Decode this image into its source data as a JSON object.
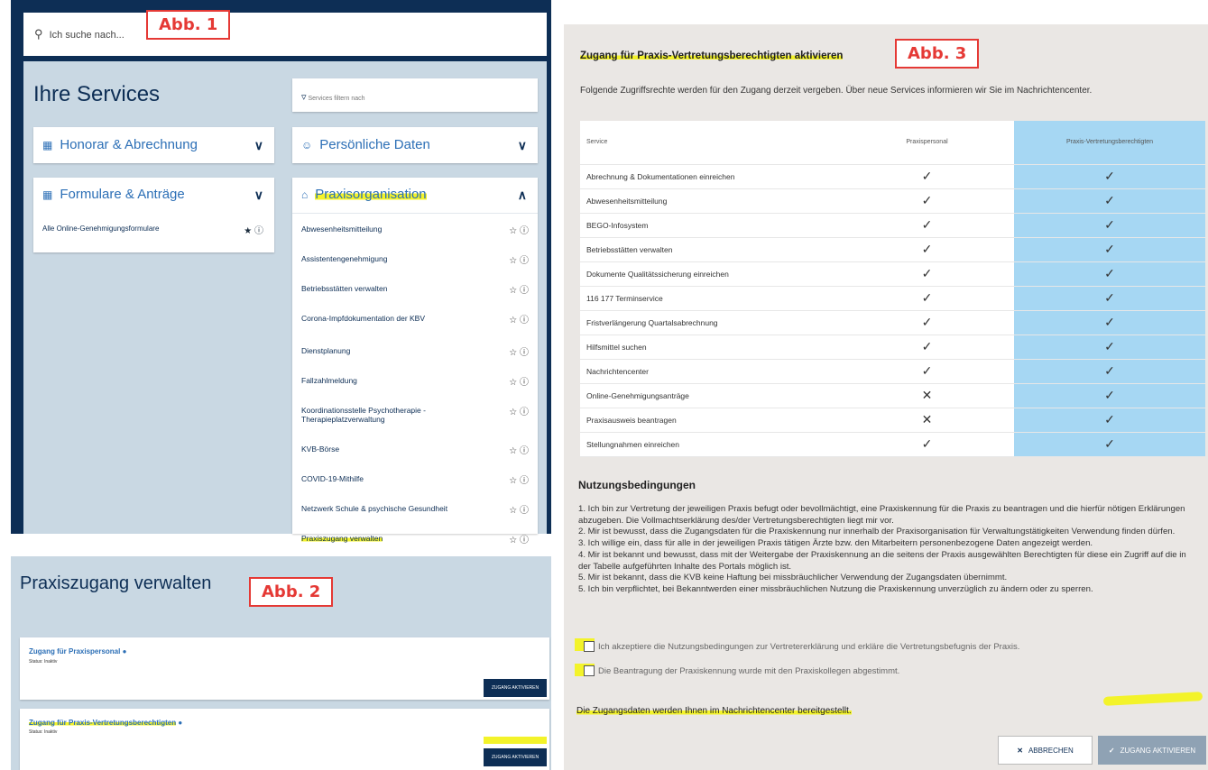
{
  "labels": {
    "abb1": "Abb. 1",
    "abb2": "Abb. 2",
    "abb3": "Abb. 3"
  },
  "abb1": {
    "search_placeholder": "Ich suche nach...",
    "title": "Ihre Services",
    "filter_placeholder": "Services filtern nach",
    "cards": {
      "honorar": "Honorar & Abrechnung",
      "personal": "Persönliche Daten",
      "formulare": "Formulare & Anträge",
      "praxis": "Praxisorganisation"
    },
    "formulare_items": [
      "Alle Online-Genehmigungsformulare"
    ],
    "praxis_items": [
      "Abwesenheitsmitteilung",
      "Assistentengenehmigung",
      "Betriebsstätten verwalten",
      "Corona-Impfdokumentation der KBV",
      "Dienstplanung",
      "Fallzahlmeldung",
      "Koordinationsstelle Psychotherapie - Therapieplatzverwaltung",
      "KVB-Börse",
      "COVID-19-Mithilfe",
      "Netzwerk Schule & psychische Gesundheit",
      "Praxiszugang verwalten"
    ]
  },
  "abb2": {
    "title": "Praxiszugang verwalten",
    "card1": {
      "title": "Zugang für Praxispersonal",
      "status": "Status: Inaktiv",
      "button": "ZUGANG AKTIVIEREN"
    },
    "card2": {
      "title": "Zugang für Praxis-Vertretungsberechtigten",
      "status": "Status: Inaktiv",
      "button": "ZUGANG AKTIVIEREN"
    }
  },
  "abb3": {
    "title": "Zugang für Praxis-Vertretungsberechtigten aktivieren",
    "intro": "Folgende Zugriffsrechte werden für den Zugang derzeit vergeben. Über neue Services informieren wir Sie im Nachrichtencenter.",
    "headers": [
      "Service",
      "Praxispersonal",
      "Praxis-Vertretungsberechtigten"
    ],
    "rows": [
      {
        "service": "Abrechnung & Dokumentationen einreichen",
        "personal": "✓",
        "vertretung": "✓"
      },
      {
        "service": "Abwesenheitsmitteilung",
        "personal": "✓",
        "vertretung": "✓"
      },
      {
        "service": "BEGO-Infosystem",
        "personal": "✓",
        "vertretung": "✓"
      },
      {
        "service": "Betriebsstätten verwalten",
        "personal": "✓",
        "vertretung": "✓"
      },
      {
        "service": "Dokumente Qualitätssicherung einreichen",
        "personal": "✓",
        "vertretung": "✓"
      },
      {
        "service": "116 177 Terminservice",
        "personal": "✓",
        "vertretung": "✓"
      },
      {
        "service": "Fristverlängerung Quartalsabrechnung",
        "personal": "✓",
        "vertretung": "✓"
      },
      {
        "service": "Hilfsmittel suchen",
        "personal": "✓",
        "vertretung": "✓"
      },
      {
        "service": "Nachrichtencenter",
        "personal": "✓",
        "vertretung": "✓"
      },
      {
        "service": "Online-Genehmigungsanträge",
        "personal": "✕",
        "vertretung": "✓"
      },
      {
        "service": "Praxisausweis beantragen",
        "personal": "✕",
        "vertretung": "✓"
      },
      {
        "service": "Stellungnahmen einreichen",
        "personal": "✓",
        "vertretung": "✓"
      }
    ],
    "terms_title": "Nutzungsbedingungen",
    "terms": [
      "1. Ich bin zur Vertretung der jeweiligen Praxis befugt oder bevollmächtigt, eine Praxiskennung für die Praxis zu beantragen und die hierfür nötigen Erklärungen abzugeben. Die Vollmachtserklärung des/der Vertretungsberechtigten liegt mir vor.",
      "2. Mir ist bewusst, dass die Zugangsdaten für die Praxiskennung nur innerhalb der Praxisorganisation für Verwaltungstätigkeiten Verwendung finden dürfen.",
      "3. Ich willige ein, dass für alle in der jeweiligen Praxis tätigen Ärzte bzw. den Mitarbeitern personenbezogene Daten angezeigt werden.",
      "4. Mir ist bekannt und bewusst, dass mit der Weitergabe der Praxiskennung an die seitens der Praxis ausgewählten Berechtigten für diese ein Zugriff auf die in der Tabelle aufgeführten Inhalte des Portals möglich ist.",
      "5. Mir ist bekannt, dass die KVB keine Haftung bei missbräuchlicher Verwendung der Zugangsdaten übernimmt.",
      "5. Ich bin verpflichtet, bei Bekanntwerden einer missbräuchlichen Nutzung die Praxiskennung unverzüglich zu ändern oder zu sperren."
    ],
    "check1": "Ich akzeptiere die Nutzungsbedingungen zur Vertretererklärung und erkläre die Vertretungsbefugnis der Praxis.",
    "check2": "Die Beantragung der Praxiskennung wurde mit den Praxiskollegen abgestimmt.",
    "notice": "Die Zugangsdaten werden Ihnen im Nachrichtencenter bereitgestellt.",
    "cancel": "ABBRECHEN",
    "activate": "ZUGANG AKTIVIEREN"
  }
}
